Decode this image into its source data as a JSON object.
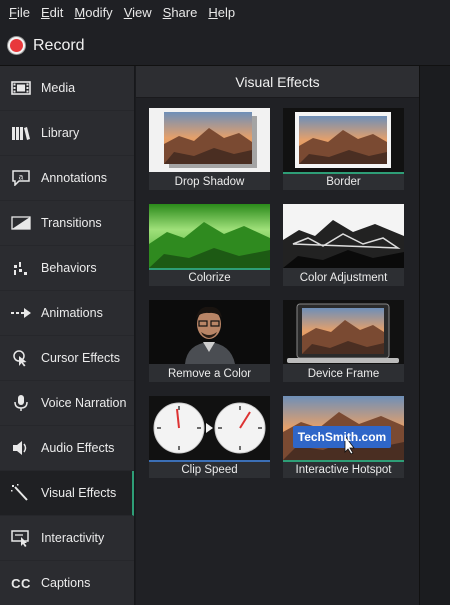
{
  "menu": [
    "File",
    "Edit",
    "Modify",
    "View",
    "Share",
    "Help"
  ],
  "record": {
    "label": "Record"
  },
  "sidebar": {
    "items": [
      {
        "label": "Media",
        "icon": "film-strip-icon"
      },
      {
        "label": "Library",
        "icon": "books-icon"
      },
      {
        "label": "Annotations",
        "icon": "speech-bubble-icon"
      },
      {
        "label": "Transitions",
        "icon": "transition-icon"
      },
      {
        "label": "Behaviors",
        "icon": "behaviors-icon"
      },
      {
        "label": "Animations",
        "icon": "animation-arrow-icon"
      },
      {
        "label": "Cursor Effects",
        "icon": "cursor-icon"
      },
      {
        "label": "Voice Narration",
        "icon": "microphone-icon"
      },
      {
        "label": "Audio Effects",
        "icon": "speaker-icon"
      },
      {
        "label": "Visual Effects",
        "icon": "magic-wand-icon"
      },
      {
        "label": "Interactivity",
        "icon": "interactivity-icon"
      },
      {
        "label": "Captions",
        "icon": "cc-icon"
      }
    ],
    "active": "Visual Effects"
  },
  "panel": {
    "title": "Visual Effects",
    "effects": [
      {
        "label": "Drop Shadow"
      },
      {
        "label": "Border"
      },
      {
        "label": "Colorize"
      },
      {
        "label": "Color Adjustment"
      },
      {
        "label": "Remove a Color"
      },
      {
        "label": "Device Frame"
      },
      {
        "label": "Clip Speed"
      },
      {
        "label": "Interactive Hotspot",
        "overlay_text": "TechSmith.com"
      }
    ]
  },
  "colors": {
    "accent_green": "#2e9e77",
    "accent_blue": "#3b6fb6",
    "record_red": "#e8383b"
  }
}
